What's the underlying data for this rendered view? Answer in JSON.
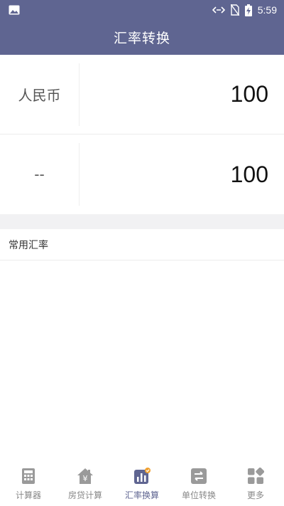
{
  "statusbar": {
    "time": "5:59"
  },
  "appbar": {
    "title": "汇率转换"
  },
  "converter": {
    "from": {
      "currency": "人民币",
      "amount": "100"
    },
    "to": {
      "currency": "--",
      "amount": "100"
    }
  },
  "section": {
    "title": "常用汇率"
  },
  "tabs": [
    {
      "label": "计算器",
      "icon": "calculator-icon"
    },
    {
      "label": "房贷计算",
      "icon": "house-loan-icon"
    },
    {
      "label": "汇率换算",
      "icon": "exchange-chart-icon",
      "active": true
    },
    {
      "label": "单位转换",
      "icon": "swap-icon"
    },
    {
      "label": "更多",
      "icon": "more-grid-icon"
    }
  ],
  "colors": {
    "primary": "#5f6591",
    "inactive": "#888888",
    "active_accent": "#f0a030"
  }
}
